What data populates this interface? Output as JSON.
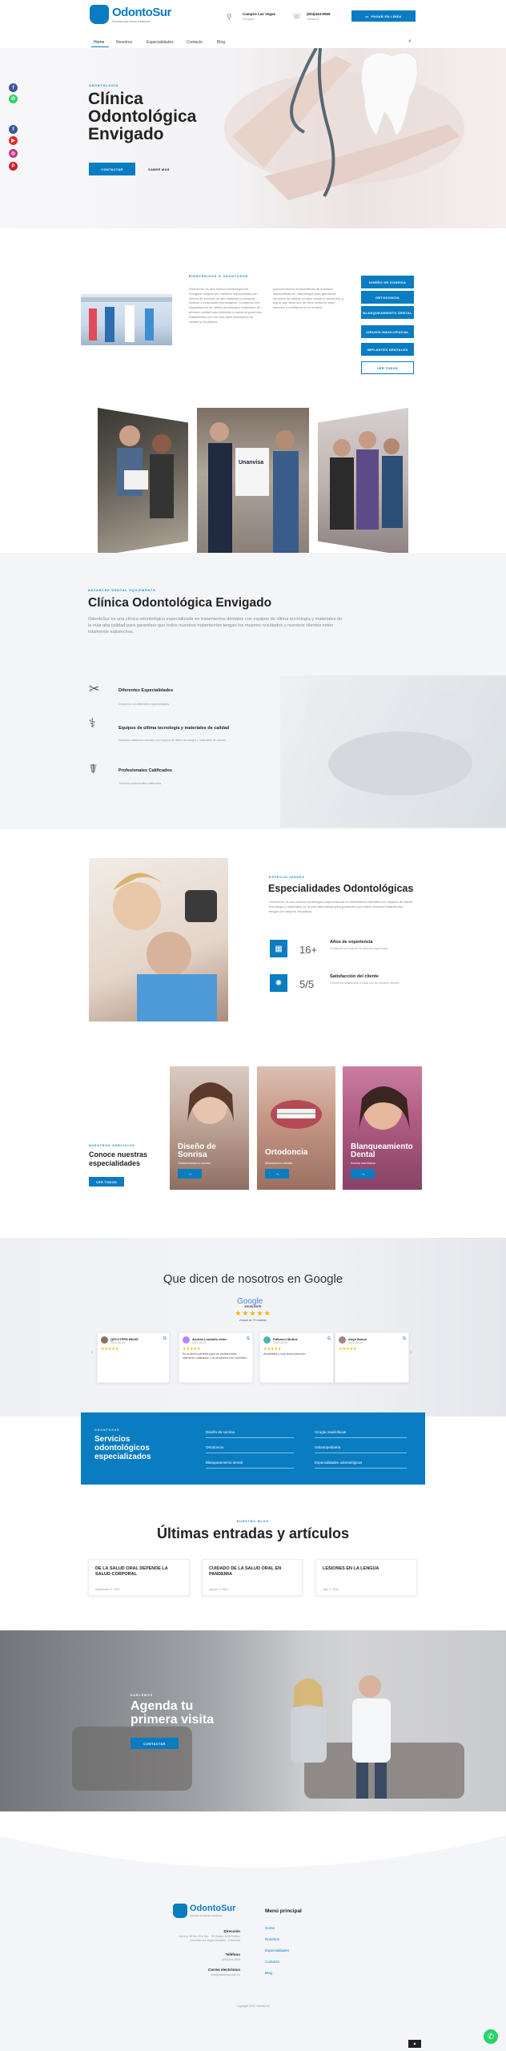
{
  "header": {
    "logo_text": "OdontoSur",
    "logo_sub": "Sonrisas que llenan corazones",
    "location_title": "Campos Las Vegas",
    "location_sub": "Envigado",
    "phone_title": "(604)444-5555",
    "phone_sub": "Llámanos",
    "cta": "PAGAR EN LÍNEA"
  },
  "nav": {
    "items": [
      "Home",
      "Nosotros",
      "Especialidades",
      "Contacto",
      "Blog"
    ]
  },
  "hero": {
    "eyebrow": "Odontología",
    "title": "Clínica Odontológica Envigado",
    "btn_primary": "Contactar",
    "btn_secondary": "Saber más"
  },
  "intro": {
    "eyebrow": "Bienvenidos a OdontoSur",
    "col1": "OdontoSur es una clínica odontológica en Envigado dirigida por nuestros especialistas con criterio de servicio de alto estándar y enfoques clínicos y avanzados tecnológicos. Contamos con equipamiento de última tecnología y materiales de primera calidad para brindarle a nuestros pacientes tratamientos con los más altos estándares de calidad y resultados.",
    "col2": "Aprovechamos la experiencia de nuestros especialistas en odontología para garantizar servicios de calidad a todos nuestros pacientes, y lograr que cada uno de ellos reciba la mejor atención y confianza en su sonrisa.",
    "side_buttons": [
      "Diseño de Sonrisa",
      "Ortodoncia",
      "Blanqueamiento Dental",
      "Cirugía Maxilofacial",
      "Implantes Dentales",
      "Ver Todos"
    ]
  },
  "about": {
    "eyebrow": "Advanced dental equipments",
    "title": "Clínica Odontológica Envigado",
    "text": "OdontoSur es una clínica odontológica especializada en tratamientos dentales con equipos de última tecnología y materiales de la más alta calidad para garantizar que todos nuestros tratamientos tengan los mejores resultados y nuestros clientes estén totalmente satisfechos.",
    "features": [
      {
        "title": "Diferentes Especialidades",
        "desc": "Contamos con diferentes especialidades"
      },
      {
        "title": "Equipos de última tecnología y materiales de calidad",
        "desc": "Nuestras instalación cuentan con equipos de última tecnología y materiales de calidad"
      },
      {
        "title": "Profesionales Calificados",
        "desc": "Tenemos profesionales calificados"
      }
    ]
  },
  "specialties_intro": {
    "eyebrow": "Especialidades",
    "title": "Especialidades Odontológicas",
    "text": "OdontoSur es una clínica odontológica especializada en tratamientos dentales con equipos de última tecnología y materiales de la más alta calidad para garantizar que todos nuestros tratamientos tengan los mejores resultados.",
    "stat1_value": "16+",
    "stat1_title": "Años de experiencia",
    "stat1_desc": "Contamos con más de 16 años de experiencia",
    "stat2_value": "5/5",
    "stat2_title": "Satisfacción del cliente",
    "stat2_desc": "Ofrecemos satisfacción a cada uno de nuestros clientes"
  },
  "services": {
    "eyebrow": "Nuestros servicios",
    "title": "Conoce nuestras especialidades",
    "btn": "Ver todos",
    "cards": [
      {
        "title": "Diseño de Sonrisa",
        "sub": "Transformamos tu sonrisa"
      },
      {
        "title": "Ortodoncia",
        "sub": "Alineamos tus dientes"
      },
      {
        "title": "Blanqueamiento Dental",
        "sub": "Sonrisa más blanca"
      }
    ]
  },
  "reviews": {
    "title": "Que dicen de nosotros en Google",
    "google": "Google",
    "rating_label": "EXCELENTE",
    "rating_sub": "A base de 79 reseñas",
    "items": [
      {
        "name": "QECVTFRS BNJIS",
        "date": "2022-05-16",
        "text": ""
      },
      {
        "name": "Andrea Londoño Velez",
        "date": "2022-05-11",
        "text": "Es la clínica perfecta para los profesionales, altamente calificados. Los resultados son increíbles."
      },
      {
        "name": "Pdlbmcn Muñoz",
        "date": "2022-03-09",
        "text": "Amabilidad y muy buena atención"
      },
      {
        "name": "Alejo Sanca",
        "date": "2022-02-18",
        "text": ""
      }
    ]
  },
  "services_band": {
    "eyebrow": "Odontosur",
    "title": "Servicios odontológicos especializados",
    "col1": [
      "Diseño de sonrisa",
      "Ortodoncia",
      "Blanqueamiento dental"
    ],
    "col2": [
      "Cirugía maxilofacial",
      "Odontopediatría",
      "Especialidades odontológicas"
    ]
  },
  "blog": {
    "eyebrow": "Nuestro Blog",
    "title": "Últimas entradas y artículos",
    "posts": [
      {
        "title": "DE LA SALUD ORAL DEPENDE LA SALUD CORPORAL",
        "date": "Septiembre 9, 2022"
      },
      {
        "title": "CUIDADO DE LA SALUD ORAL EN PANDEMIA",
        "date": "Agosto 3, 2022"
      },
      {
        "title": "LESIONES EN LA LENGUA",
        "date": "Julio 2, 2022"
      }
    ]
  },
  "cta": {
    "eyebrow": "Hablemos",
    "title": "Agenda tu primera visita",
    "btn": "Contactar"
  },
  "footer": {
    "address_label": "Dirección",
    "address": "Carrera 48 Sur 39 A Sur - 78 Oficina 1108 Edificio Consulta Las Vegas Medellín - Colombia",
    "phone_label": "Teléfono",
    "phone": "(604)444-5555",
    "email_label": "Correo electrónico",
    "email": "info@odontosur.com.co",
    "menu_title": "Menú principal",
    "menu": [
      "Home",
      "Nosotros",
      "Especialidades",
      "Contacto",
      "Blog"
    ],
    "copyright": "Copyright 2022 OdontoSur"
  },
  "colors": {
    "primary": "#0a7cc1",
    "dark": "#222222"
  }
}
